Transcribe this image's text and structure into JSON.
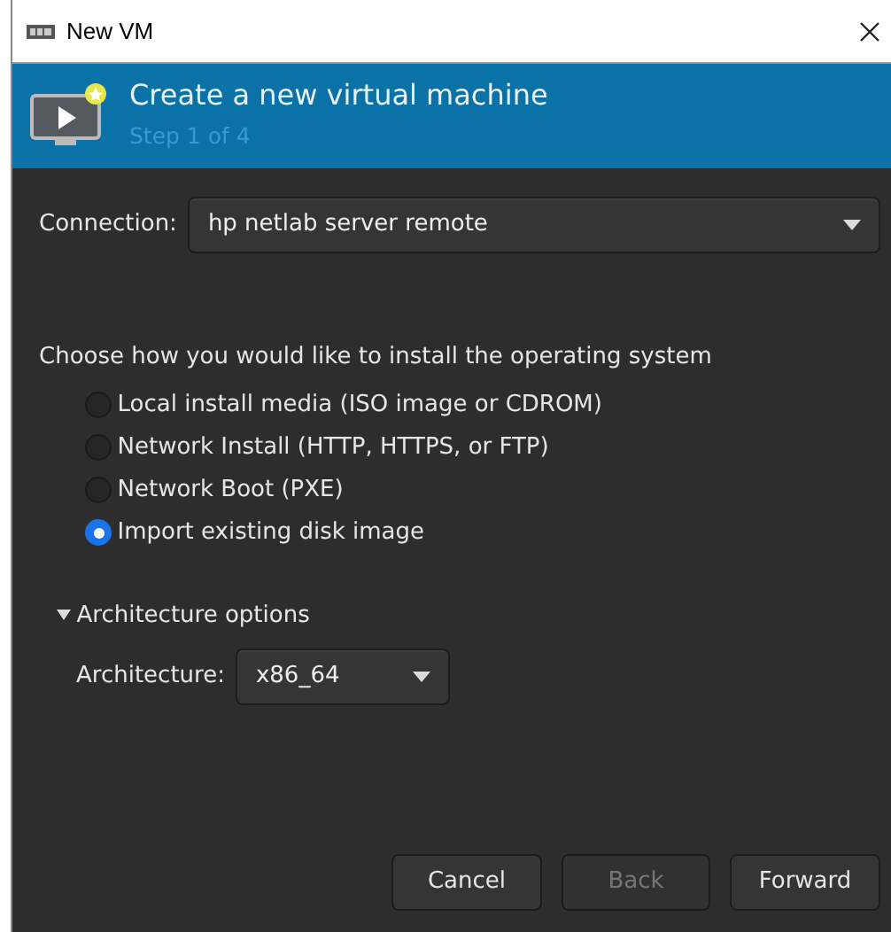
{
  "window": {
    "title": "New VM"
  },
  "header": {
    "title": "Create a new virtual machine",
    "step": "Step 1 of 4"
  },
  "connection": {
    "label": "Connection:",
    "value": "hp netlab server remote"
  },
  "install": {
    "prompt": "Choose how you would like to install the operating system",
    "options": [
      {
        "label": "Local install media (ISO image or CDROM)",
        "selected": false
      },
      {
        "label": "Network Install (HTTP, HTTPS, or FTP)",
        "selected": false
      },
      {
        "label": "Network Boot (PXE)",
        "selected": false
      },
      {
        "label": "Import existing disk image",
        "selected": true
      }
    ]
  },
  "architecture": {
    "label": "Architecture options",
    "expanded": true,
    "field_label": "Architecture:",
    "value": "x86_64"
  },
  "buttons": [
    {
      "label": "Cancel",
      "disabled": false
    },
    {
      "label": "Back",
      "disabled": true
    },
    {
      "label": "Forward",
      "disabled": false
    }
  ]
}
